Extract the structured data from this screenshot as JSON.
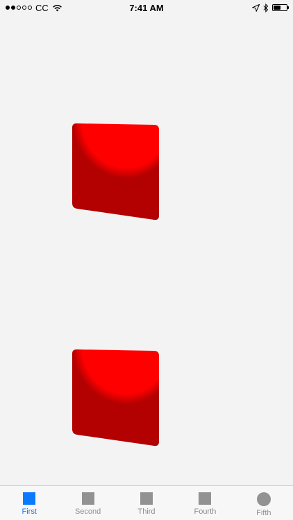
{
  "status_bar": {
    "carrier": "CC",
    "time": "7:41 AM",
    "signal_filled": 2,
    "signal_total": 5,
    "battery_level": 0.55,
    "icons": [
      "wifi-icon",
      "location-arrow-icon",
      "bluetooth-icon",
      "battery-icon"
    ]
  },
  "tiles": {
    "color_top": "#ff0000",
    "color_bottom": "#b30000"
  },
  "tab_bar": {
    "active_color": "#0a7aff",
    "inactive_color": "#929292",
    "tabs": [
      {
        "label": "First",
        "icon": "square-icon",
        "active": true
      },
      {
        "label": "Second",
        "icon": "square-icon",
        "active": false
      },
      {
        "label": "Third",
        "icon": "square-icon",
        "active": false
      },
      {
        "label": "Fourth",
        "icon": "square-icon",
        "active": false
      },
      {
        "label": "Fifth",
        "icon": "circle-icon",
        "active": false
      }
    ]
  }
}
